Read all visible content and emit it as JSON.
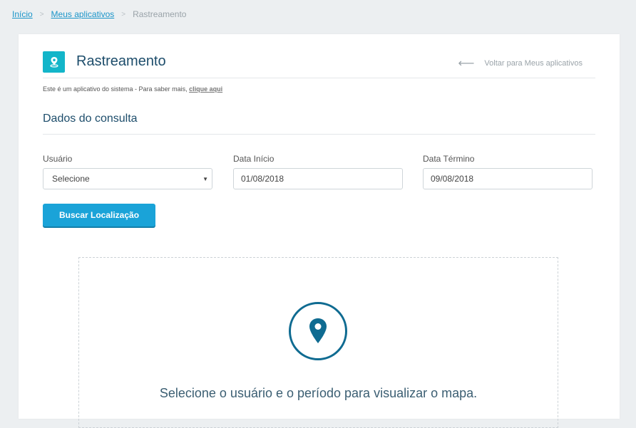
{
  "breadcrumb": {
    "items": [
      "Início",
      "Meus aplicativos"
    ],
    "separator": ">",
    "current": "Rastreamento"
  },
  "header": {
    "title": "Rastreamento",
    "back_label": "Voltar para Meus aplicativos",
    "app_icon": "map-pin-icon",
    "accent": "#13b5c9"
  },
  "system_note": {
    "text": "Este é um aplicativo do sistema - Para saber mais, ",
    "link": "clique aqui"
  },
  "form": {
    "section_title": "Dados do consulta",
    "usuario_label": "Usuário",
    "usuario_value": "Selecione",
    "data_inicio_label": "Data Início",
    "data_inicio_value": "01/08/2018",
    "data_termino_label": "Data Término",
    "data_termino_value": "09/08/2018",
    "search_button": "Buscar Localização",
    "button_color": "#1aa3d8"
  },
  "map_placeholder": {
    "icon": "map-pin-icon",
    "message": "Selecione o usuário e o período para visualizar o mapa."
  }
}
